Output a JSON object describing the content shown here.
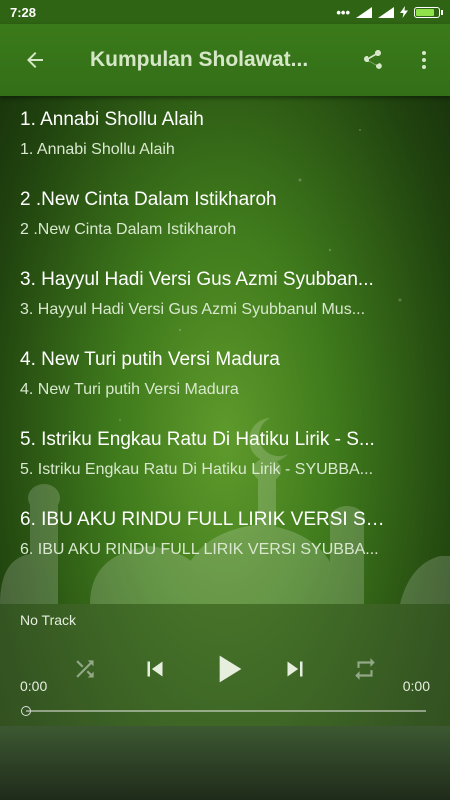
{
  "status": {
    "time": "7:28",
    "dots": "•••",
    "battery_level": 0.9
  },
  "appbar": {
    "title": "Kumpulan Sholawat..."
  },
  "songs": [
    {
      "title": "1. Annabi Shollu Alaih",
      "subtitle": "1. Annabi Shollu Alaih"
    },
    {
      "title": "2 .New Cinta Dalam Istikharoh",
      "subtitle": "2 .New Cinta Dalam Istikharoh"
    },
    {
      "title": "3. Hayyul Hadi Versi Gus Azmi Syubban...",
      "subtitle": "3. Hayyul Hadi Versi Gus Azmi Syubbanul Mus..."
    },
    {
      "title": "4. New Turi putih Versi Madura",
      "subtitle": "4. New Turi putih Versi Madura"
    },
    {
      "title": "5. Istriku Engkau Ratu Di Hatiku Lirik - S...",
      "subtitle": "5. Istriku Engkau Ratu Di Hatiku Lirik - SYUBBA..."
    },
    {
      "title": "6. IBU AKU RINDU FULL LIRIK VERSI SY...",
      "subtitle": "6. IBU AKU RINDU FULL LIRIK VERSI SYUBBA..."
    }
  ],
  "player": {
    "track": "No Track",
    "elapsed": "0:00",
    "duration": "0:00",
    "progress": 0
  },
  "icons": [
    "back-arrow-icon",
    "share-icon",
    "more-vert-icon",
    "shuffle-icon",
    "previous-icon",
    "play-icon",
    "next-icon",
    "repeat-icon",
    "signal-icon",
    "charging-icon"
  ],
  "colors": {
    "appbar": "#3b7a1b",
    "battery_fill": "#8fe24a"
  }
}
